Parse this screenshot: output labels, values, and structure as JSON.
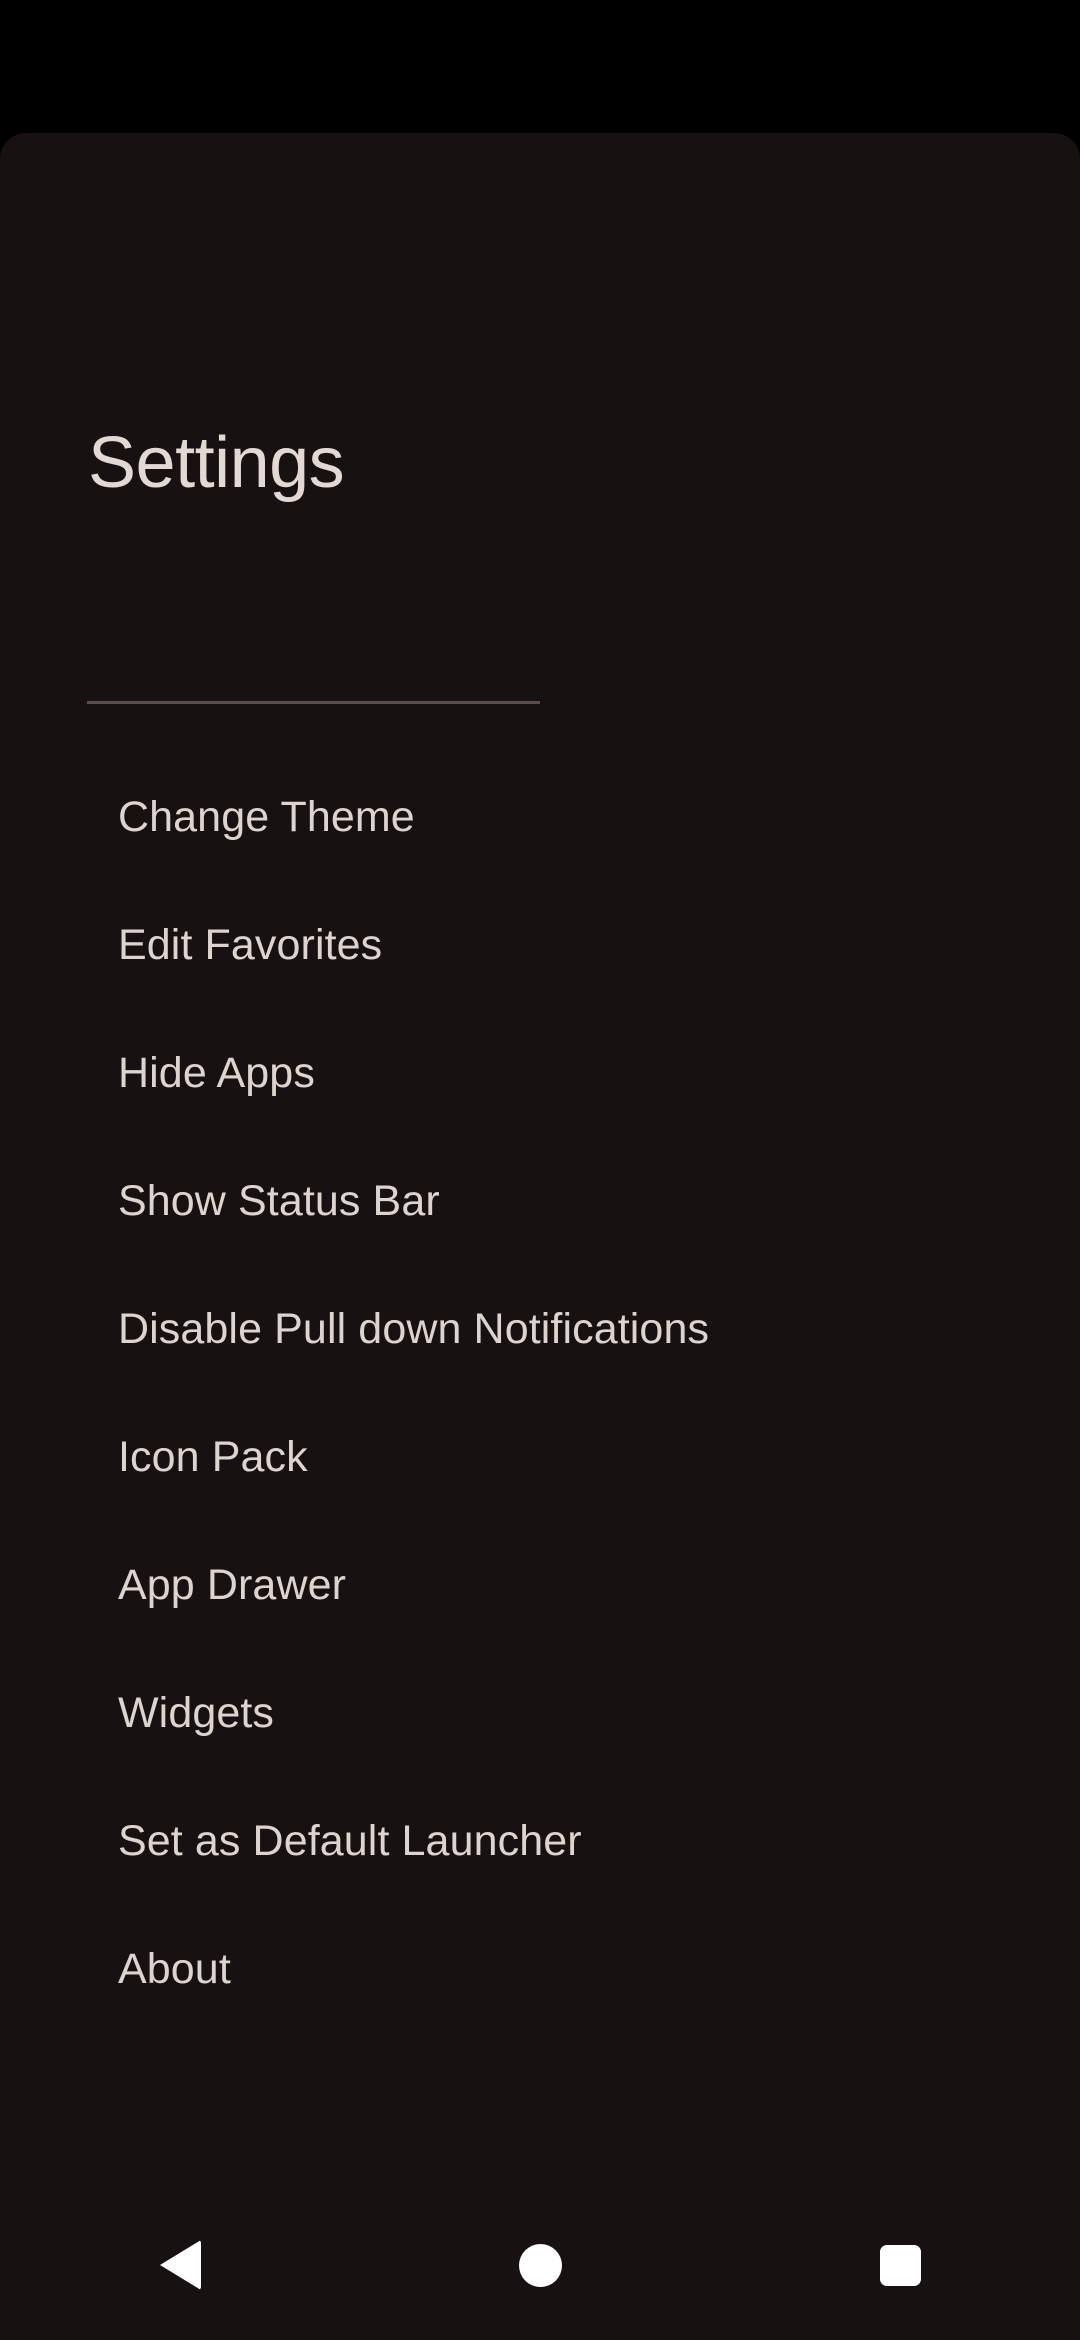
{
  "screen": {
    "background_color": "#171211",
    "status_bar_color": "#000000",
    "text_color": "#ddd3cf",
    "divider_color": "#5b4e4a"
  },
  "settings": {
    "title": "Settings",
    "items": [
      {
        "label": "Change Theme"
      },
      {
        "label": "Edit Favorites"
      },
      {
        "label": "Hide Apps"
      },
      {
        "label": "Show Status Bar"
      },
      {
        "label": "Disable Pull down Notifications"
      },
      {
        "label": "Icon Pack"
      },
      {
        "label": "App Drawer"
      },
      {
        "label": "Widgets"
      },
      {
        "label": "Set as Default Launcher"
      },
      {
        "label": "About"
      }
    ]
  },
  "navigation_bar": {
    "buttons": [
      {
        "name": "back",
        "icon": "triangle-left-icon"
      },
      {
        "name": "home",
        "icon": "circle-icon"
      },
      {
        "name": "recents",
        "icon": "square-icon"
      }
    ]
  }
}
